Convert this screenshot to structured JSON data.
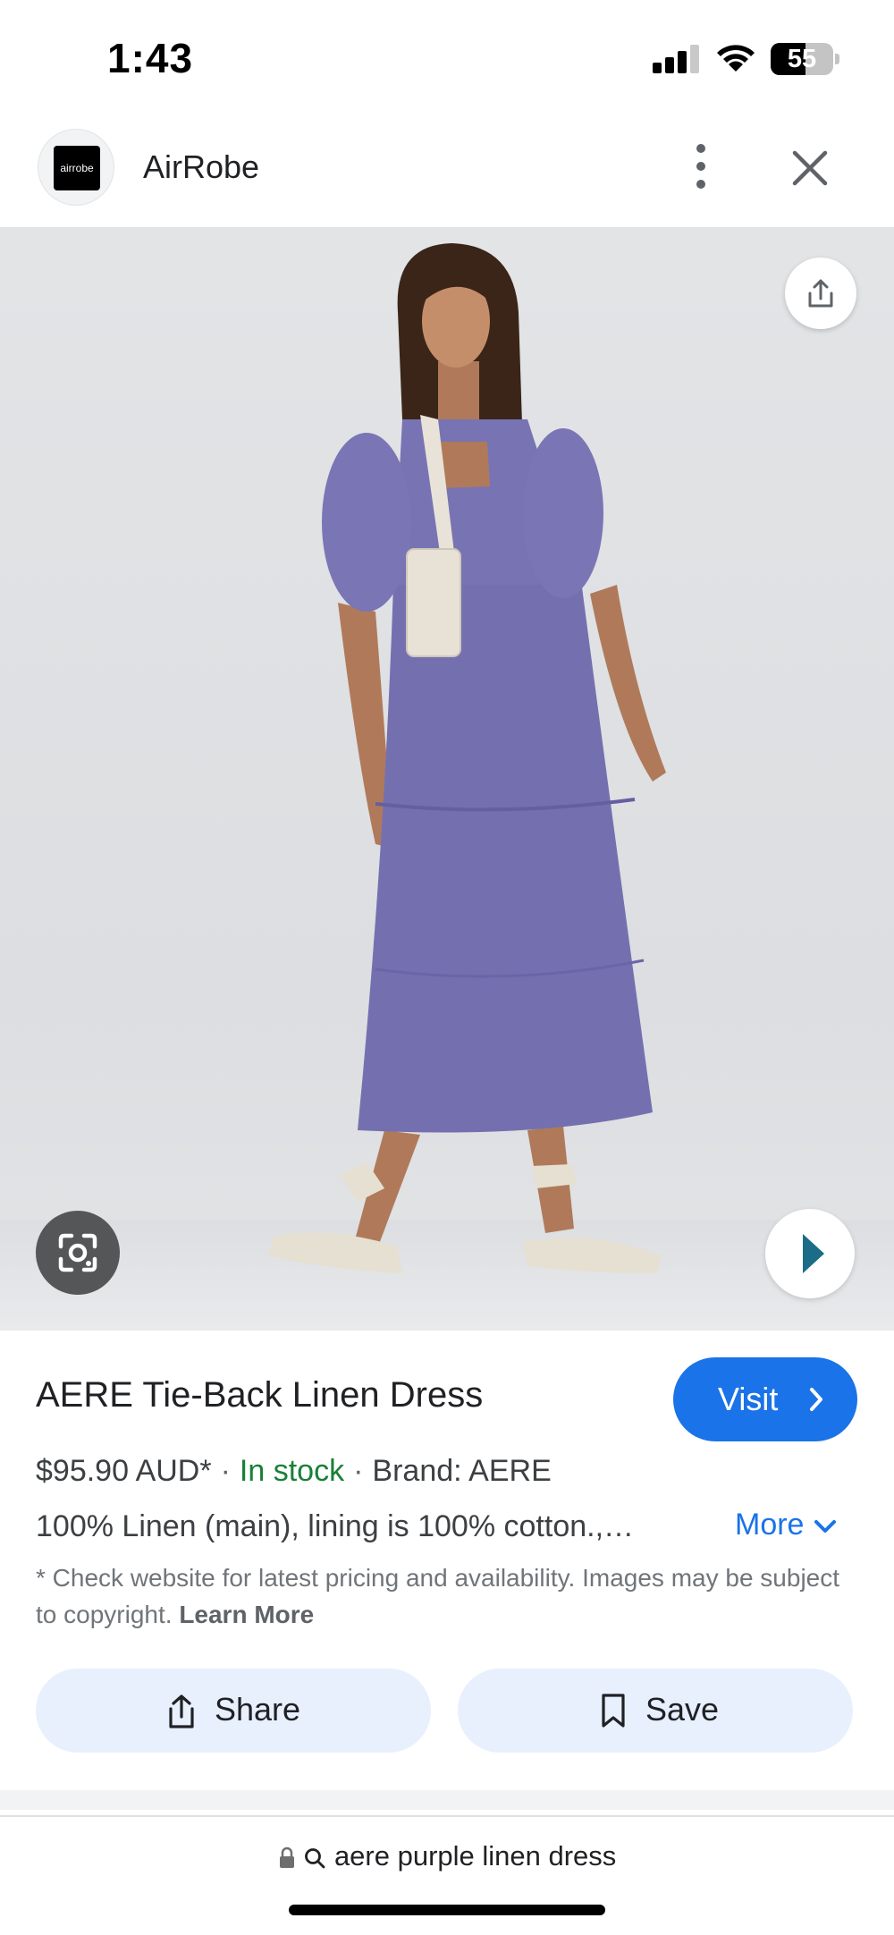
{
  "status_bar": {
    "time": "1:43",
    "battery_level": "55",
    "battery_percent": 55
  },
  "header": {
    "site_logo_text": "airrobe",
    "site_name": "AirRobe"
  },
  "product": {
    "title": "AERE Tie-Back Linen Dress",
    "price": "$95.90 AUD*",
    "stock": "In stock",
    "brand": "Brand: AERE",
    "description": "100% Linen (main), lining is 100% cotton.,…",
    "more_label": "More",
    "disclaimer": "* Check website for latest pricing and availability. Images may be subject to copyright.",
    "learn_more": "Learn More"
  },
  "actions": {
    "visit_label": "Visit",
    "share_label": "Share",
    "save_label": "Save"
  },
  "address_bar": {
    "query": "aere purple linen dress"
  },
  "colors": {
    "accent": "#1a73e8",
    "in_stock": "#188038",
    "action_bg": "#e8f0fe",
    "dress": "#7470b0"
  },
  "icons": [
    "signal-icon",
    "wifi-icon",
    "battery-icon",
    "more-vert-icon",
    "close-icon",
    "share-icon",
    "lens-icon",
    "next-arrow-icon",
    "chevron-right-icon",
    "chevron-down-icon",
    "bookmark-icon",
    "lock-icon",
    "search-icon"
  ]
}
